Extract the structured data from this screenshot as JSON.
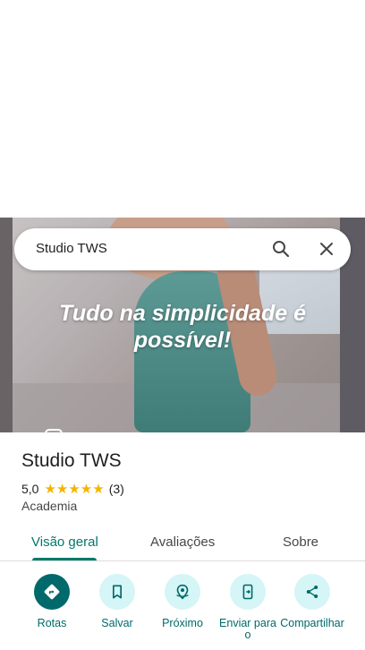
{
  "search": {
    "query": "Studio TWS"
  },
  "hero": {
    "headline_line1": "Tudo na simplicidade é",
    "headline_line2": "possível!"
  },
  "place": {
    "name": "Studio TWS",
    "rating": "5,0",
    "stars": "★★★★★",
    "review_count": "(3)",
    "category": "Academia"
  },
  "tabs": [
    {
      "label": "Visão geral",
      "active": true
    },
    {
      "label": "Avaliações",
      "active": false
    },
    {
      "label": "Sobre",
      "active": false
    }
  ],
  "actions": [
    {
      "label": "Rotas",
      "icon": "directions-icon"
    },
    {
      "label": "Salvar",
      "icon": "bookmark-icon"
    },
    {
      "label": "Próximo",
      "icon": "nearby-icon"
    },
    {
      "label": "Enviar para o",
      "icon": "send-to-phone-icon"
    },
    {
      "label": "Compartilhar",
      "icon": "share-icon"
    }
  ],
  "colors": {
    "accent": "#00796b",
    "action_circle": "#d5f5f6",
    "primary_circle": "#00696b",
    "star": "#f4b400"
  }
}
